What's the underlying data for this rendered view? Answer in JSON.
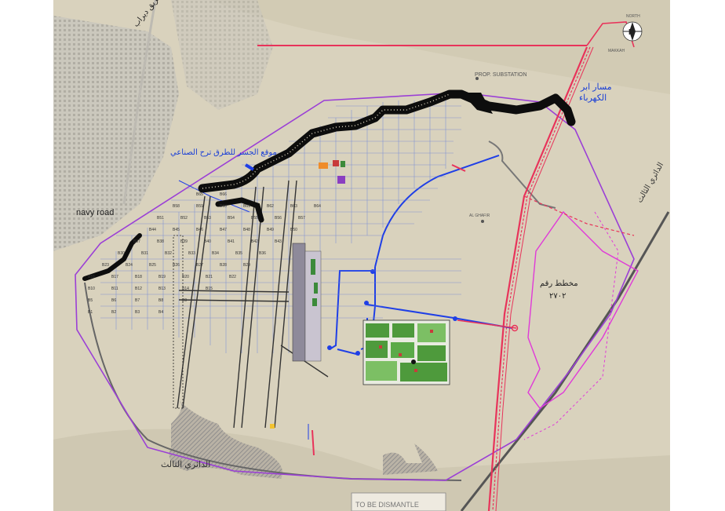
{
  "labels": {
    "navy_road": "navy road",
    "road_ar_top": "طريق ديراب",
    "blue_ar_right_1": "مسار ابر",
    "blue_ar_right_2": "الكهرباء",
    "blue_ar_left": "موقع الجسر للطرق ترح الصناعي",
    "plan_ar_1": "مخطط رقم",
    "plan_ar_2": "٢٧٠٢",
    "ring_ar_bottom": "الدائري الثالث",
    "ring_ar_right": "الدائري الثالث",
    "prop_substation": "PROP. SUBSTATION",
    "north": "NORTH",
    "makkah": "MAKKAH",
    "to_be_dismantled": "TO BE DISMANTLE",
    "al_ghafir": "AL GHAFIR"
  },
  "colors": {
    "terrain": "#d9d2bd",
    "boundary": "#9b3fd6",
    "powerline": "#e8335a",
    "proposed_route": "#1f3fe6",
    "plan_area": "#e03ad8",
    "wadi": "#0d0d0d",
    "ring_road": "#555555"
  },
  "parcels": [
    "B1",
    "B2",
    "B3",
    "B4",
    "B5",
    "B6",
    "B7",
    "B8",
    "B9",
    "B10",
    "B11",
    "B12",
    "B13",
    "B14",
    "B15",
    "B16",
    "B17",
    "B18",
    "B19",
    "B20",
    "B21",
    "B22",
    "B23",
    "B24",
    "B25",
    "B26",
    "B27",
    "B28",
    "B29",
    "B30",
    "B31",
    "B32",
    "B33",
    "B34",
    "B35",
    "B36",
    "B37",
    "B38",
    "B39",
    "B40",
    "B41",
    "B42",
    "B43",
    "B44",
    "B45",
    "B46",
    "B47",
    "B48",
    "B49",
    "B50",
    "B51",
    "B52",
    "B53",
    "B54",
    "B55",
    "B56",
    "B57",
    "B58",
    "B59",
    "B60",
    "B61",
    "B62",
    "B63",
    "B64",
    "B65",
    "B66"
  ]
}
